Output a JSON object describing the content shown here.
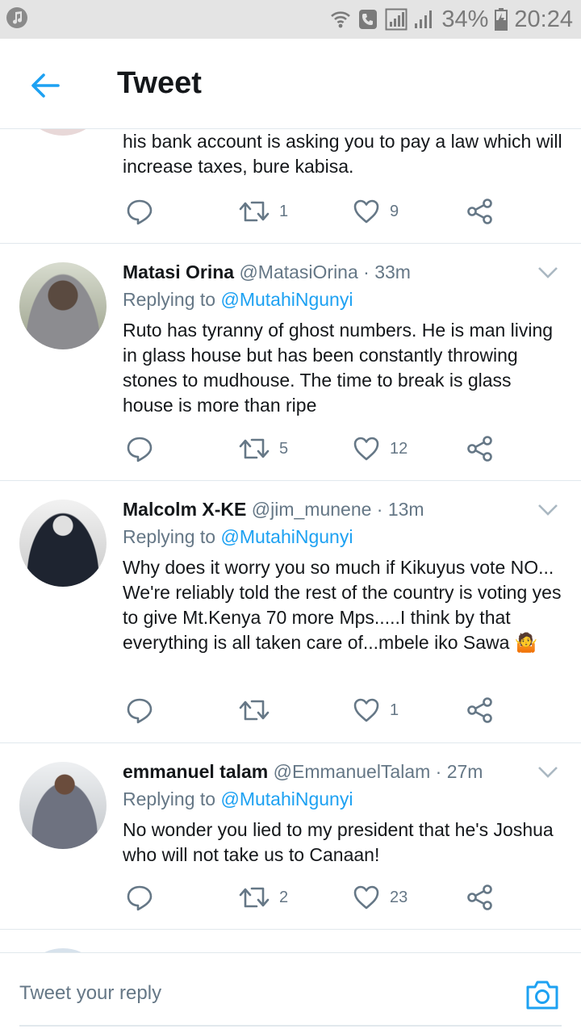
{
  "status_bar": {
    "battery": "34%",
    "time": "20:24"
  },
  "header": {
    "title": "Tweet"
  },
  "tweets": [
    {
      "body": "his bank account is asking you to pay a law which will increase taxes, bure kabisa.",
      "retweets": "1",
      "likes": "9"
    },
    {
      "name": "Matasi Orina",
      "handle": "@MatasiOrina · 33m",
      "replying_prefix": "Replying to",
      "replying_handle": "@MutahiNgunyi",
      "body": "Ruto has tyranny of ghost numbers. He is man living in glass house but has been constantly throwing stones to mudhouse. The time to break is glass house is more than ripe",
      "retweets": "5",
      "likes": "12"
    },
    {
      "name": "Malcolm X-KE",
      "handle": "@jim_munene · 13m",
      "replying_prefix": "Replying to",
      "replying_handle": "@MutahiNgunyi",
      "body": "Why does it worry you so much if Kikuyus vote NO... We're reliably told the rest of the country is voting yes to give Mt.Kenya 70 more Mps.....I think by that everything is all taken care of...mbele iko Sawa 🤷",
      "retweets": "",
      "likes": "1"
    },
    {
      "name": "emmanuel talam",
      "handle": "@EmmanuelTalam · 27m",
      "replying_prefix": "Replying to",
      "replying_handle": "@MutahiNgunyi",
      "body": "No wonder you lied to my president that he's Joshua who will not take us to Canaan!",
      "retweets": "2",
      "likes": "23"
    }
  ],
  "reply_bar": {
    "placeholder": "Tweet your reply"
  },
  "colors": {
    "accent": "#1da1f2",
    "secondary_text": "#657786",
    "divider": "#e1e8ed"
  }
}
